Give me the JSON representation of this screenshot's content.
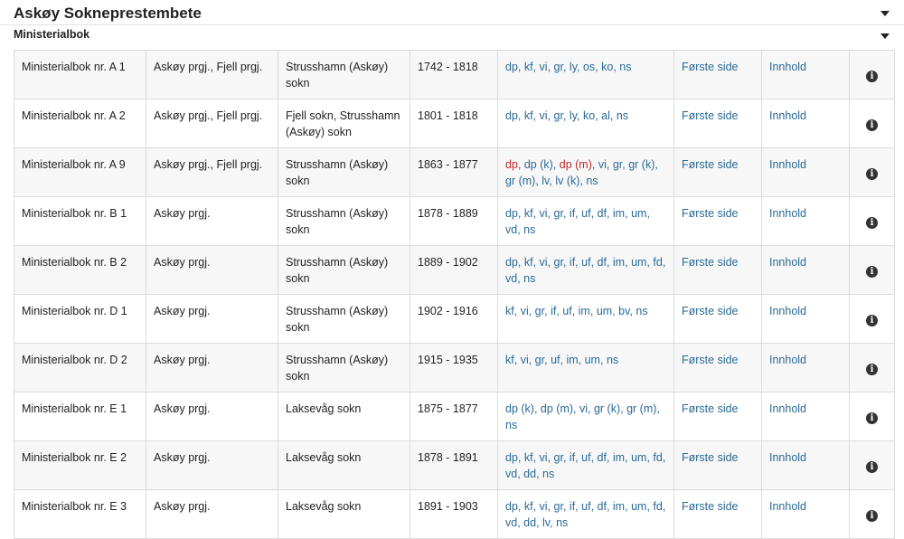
{
  "header": {
    "title": "Askøy Sokneprestembete"
  },
  "subheader": {
    "title": "Ministerialbok"
  },
  "rows": [
    {
      "name": "Ministerialbok nr. A 1",
      "parish": "Askøy prgj., Fjell prgj.",
      "place": "Strusshamn (Askøy) sokn",
      "years": "1742 - 1818",
      "types": [
        {
          "t": "dp",
          "c": "link"
        },
        {
          "t": "kf",
          "c": "link"
        },
        {
          "t": "vi",
          "c": "link"
        },
        {
          "t": "gr",
          "c": "link"
        },
        {
          "t": "ly",
          "c": "link"
        },
        {
          "t": "os",
          "c": "link"
        },
        {
          "t": "ko",
          "c": "link"
        },
        {
          "t": "ns",
          "c": "link"
        }
      ],
      "first_page": "Første side",
      "contents": "Innhold"
    },
    {
      "name": "Ministerialbok nr. A 2",
      "parish": "Askøy prgj., Fjell prgj.",
      "place": "Fjell sokn, Strusshamn (Askøy) sokn",
      "years": "1801 - 1818",
      "types": [
        {
          "t": "dp",
          "c": "link"
        },
        {
          "t": "kf",
          "c": "link"
        },
        {
          "t": "vi",
          "c": "link"
        },
        {
          "t": "gr",
          "c": "link"
        },
        {
          "t": "ly",
          "c": "link"
        },
        {
          "t": "ko",
          "c": "link"
        },
        {
          "t": "al",
          "c": "link"
        },
        {
          "t": "ns",
          "c": "link"
        }
      ],
      "first_page": "Første side",
      "contents": "Innhold"
    },
    {
      "name": "Ministerialbok nr. A 9",
      "parish": "Askøy prgj., Fjell prgj.",
      "place": "Strusshamn (Askøy) sokn",
      "years": "1863 - 1877",
      "types": [
        {
          "t": "dp",
          "c": "red"
        },
        {
          "t": "dp (k)",
          "c": "link"
        },
        {
          "t": "dp (m)",
          "c": "red"
        },
        {
          "t": "vi",
          "c": "link"
        },
        {
          "t": "gr",
          "c": "link"
        },
        {
          "t": "gr (k)",
          "c": "link"
        },
        {
          "t": "gr (m)",
          "c": "link"
        },
        {
          "t": "lv",
          "c": "link"
        },
        {
          "t": "lv (k)",
          "c": "link"
        },
        {
          "t": "ns",
          "c": "link"
        }
      ],
      "first_page": "Første side",
      "contents": "Innhold"
    },
    {
      "name": "Ministerialbok nr. B 1",
      "parish": "Askøy prgj.",
      "place": "Strusshamn (Askøy) sokn",
      "years": "1878 - 1889",
      "types": [
        {
          "t": "dp",
          "c": "link"
        },
        {
          "t": "kf",
          "c": "link"
        },
        {
          "t": "vi",
          "c": "link"
        },
        {
          "t": "gr",
          "c": "link"
        },
        {
          "t": "if",
          "c": "link"
        },
        {
          "t": "uf",
          "c": "link"
        },
        {
          "t": "df",
          "c": "link"
        },
        {
          "t": "im",
          "c": "link"
        },
        {
          "t": "um",
          "c": "link"
        },
        {
          "t": "vd",
          "c": "link"
        },
        {
          "t": "ns",
          "c": "link"
        }
      ],
      "first_page": "Første side",
      "contents": "Innhold"
    },
    {
      "name": "Ministerialbok nr. B 2",
      "parish": "Askøy prgj.",
      "place": "Strusshamn (Askøy) sokn",
      "years": "1889 - 1902",
      "types": [
        {
          "t": "dp",
          "c": "link"
        },
        {
          "t": "kf",
          "c": "link"
        },
        {
          "t": "vi",
          "c": "link"
        },
        {
          "t": "gr",
          "c": "link"
        },
        {
          "t": "if",
          "c": "link"
        },
        {
          "t": "uf",
          "c": "link"
        },
        {
          "t": "df",
          "c": "link"
        },
        {
          "t": "im",
          "c": "link"
        },
        {
          "t": "um",
          "c": "link"
        },
        {
          "t": "fd",
          "c": "link"
        },
        {
          "t": "vd",
          "c": "link"
        },
        {
          "t": "ns",
          "c": "link"
        }
      ],
      "first_page": "Første side",
      "contents": "Innhold"
    },
    {
      "name": "Ministerialbok nr. D 1",
      "parish": "Askøy prgj.",
      "place": "Strusshamn (Askøy) sokn",
      "years": "1902 - 1916",
      "types": [
        {
          "t": "kf",
          "c": "link"
        },
        {
          "t": "vi",
          "c": "link"
        },
        {
          "t": "gr",
          "c": "link"
        },
        {
          "t": "if",
          "c": "link"
        },
        {
          "t": "uf",
          "c": "link"
        },
        {
          "t": "im",
          "c": "link"
        },
        {
          "t": "um",
          "c": "link"
        },
        {
          "t": "bv",
          "c": "link"
        },
        {
          "t": "ns",
          "c": "link"
        }
      ],
      "first_page": "Første side",
      "contents": "Innhold"
    },
    {
      "name": "Ministerialbok nr. D 2",
      "parish": "Askøy prgj.",
      "place": "Strusshamn (Askøy) sokn",
      "years": "1915 - 1935",
      "types": [
        {
          "t": "kf",
          "c": "link"
        },
        {
          "t": "vi",
          "c": "link"
        },
        {
          "t": "gr",
          "c": "link"
        },
        {
          "t": "uf",
          "c": "link"
        },
        {
          "t": "im",
          "c": "link"
        },
        {
          "t": "um",
          "c": "link"
        },
        {
          "t": "ns",
          "c": "link"
        }
      ],
      "first_page": "Første side",
      "contents": "Innhold"
    },
    {
      "name": "Ministerialbok nr. E 1",
      "parish": "Askøy prgj.",
      "place": "Laksevåg sokn",
      "years": "1875 - 1877",
      "types": [
        {
          "t": "dp (k)",
          "c": "link"
        },
        {
          "t": "dp (m)",
          "c": "link"
        },
        {
          "t": "vi",
          "c": "link"
        },
        {
          "t": "gr (k)",
          "c": "link"
        },
        {
          "t": "gr (m)",
          "c": "link"
        },
        {
          "t": "ns",
          "c": "link"
        }
      ],
      "first_page": "Første side",
      "contents": "Innhold"
    },
    {
      "name": "Ministerialbok nr. E 2",
      "parish": "Askøy prgj.",
      "place": "Laksevåg sokn",
      "years": "1878 - 1891",
      "types": [
        {
          "t": "dp",
          "c": "link"
        },
        {
          "t": "kf",
          "c": "link"
        },
        {
          "t": "vi",
          "c": "link"
        },
        {
          "t": "gr",
          "c": "link"
        },
        {
          "t": "if",
          "c": "link"
        },
        {
          "t": "uf",
          "c": "link"
        },
        {
          "t": "df",
          "c": "link"
        },
        {
          "t": "im",
          "c": "link"
        },
        {
          "t": "um",
          "c": "link"
        },
        {
          "t": "fd",
          "c": "link"
        },
        {
          "t": "vd",
          "c": "link"
        },
        {
          "t": "dd",
          "c": "link"
        },
        {
          "t": "ns",
          "c": "link"
        }
      ],
      "first_page": "Første side",
      "contents": "Innhold"
    },
    {
      "name": "Ministerialbok nr. E 3",
      "parish": "Askøy prgj.",
      "place": "Laksevåg sokn",
      "years": "1891 - 1903",
      "types": [
        {
          "t": "dp",
          "c": "link"
        },
        {
          "t": "kf",
          "c": "link"
        },
        {
          "t": "vi",
          "c": "link"
        },
        {
          "t": "gr",
          "c": "link"
        },
        {
          "t": "if",
          "c": "link"
        },
        {
          "t": "uf",
          "c": "link"
        },
        {
          "t": "df",
          "c": "link"
        },
        {
          "t": "im",
          "c": "link"
        },
        {
          "t": "um",
          "c": "link"
        },
        {
          "t": "fd",
          "c": "link"
        },
        {
          "t": "vd",
          "c": "link"
        },
        {
          "t": "dd",
          "c": "link"
        },
        {
          "t": "lv",
          "c": "link"
        },
        {
          "t": "ns",
          "c": "link"
        }
      ],
      "first_page": "Første side",
      "contents": "Innhold"
    }
  ],
  "icons": {
    "toggle": "caret-down-icon",
    "info": "info-circle-icon"
  },
  "colors": {
    "link": "#2a6a96",
    "highlight": "#c0282c",
    "row_alt": "#f7f7f7"
  }
}
